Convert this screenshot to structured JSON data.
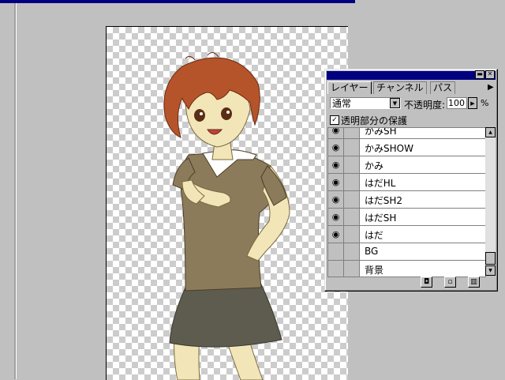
{
  "layers_palette": {
    "tabs": [
      {
        "label": "レイヤー"
      },
      {
        "label": "チャンネル"
      },
      {
        "label": "パス"
      }
    ],
    "blend_mode": "通常",
    "opacity_label": "不透明度:",
    "opacity_value": "100",
    "opacity_unit": "%",
    "preserve_transparency_label": "透明部分の保護",
    "layers": [
      {
        "name": "かみSH",
        "visible": true
      },
      {
        "name": "かみSHOW",
        "visible": true
      },
      {
        "name": "かみ",
        "visible": true
      },
      {
        "name": "はだHL",
        "visible": true
      },
      {
        "name": "はだSH2",
        "visible": true
      },
      {
        "name": "はだSH",
        "visible": true
      },
      {
        "name": "はだ",
        "visible": true
      },
      {
        "name": "BG",
        "visible": false
      },
      {
        "name": "背景",
        "visible": false
      }
    ]
  },
  "colors": {
    "title_bar": "#000080",
    "panel": "#c0c0c0",
    "hair": "#b5542a",
    "shirt": "#8c7b5a",
    "skirt": "#5e5b4f",
    "skin": "#f2e6b8"
  }
}
